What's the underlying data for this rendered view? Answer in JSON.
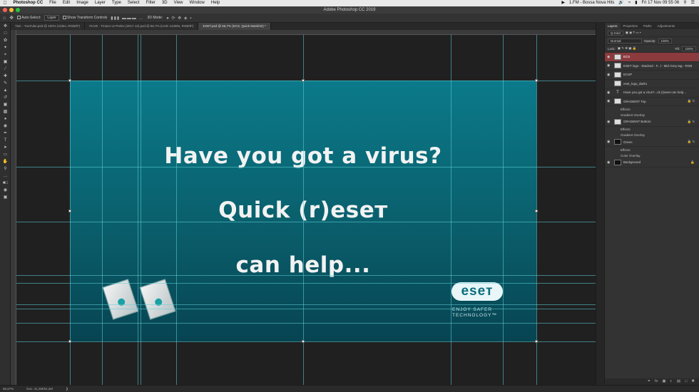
{
  "menubar": {
    "app_name": "Photoshop CC",
    "items": [
      "File",
      "Edit",
      "Image",
      "Layer",
      "Type",
      "Select",
      "Filter",
      "3D",
      "View",
      "Window",
      "Help"
    ],
    "now_playing": "1.FM - Bossa Nova Hits",
    "clock": "Fri 17 Nov  09 55 06"
  },
  "window": {
    "title": "Adobe Photoshop CC 2019"
  },
  "options": {
    "auto_select_label": "Auto-Select:",
    "auto_select_value": "Layer",
    "show_transform_label": "Show Transform Controls",
    "mode_3d_label": "3D Mode:"
  },
  "doc_tabs": [
    "T&C - YouTube.psd @ 100% (Video, RGB/8*)",
    "#LIVE - Tmavo vs Prelov (2017.12).psd @ 66,7% (LIVE 14400s, RGB/8*)",
    "ESET.psd @ 66,7% (ECS, Quick Mask/32) *"
  ],
  "artboard": {
    "line1": "Have you got a virus?",
    "line2": "Quick (r)eseт",
    "line3": "can help...",
    "logo_text": "eseт",
    "tagline1": "ENJOY SAFER",
    "tagline2": "TECHNOLOGY™"
  },
  "panel": {
    "tabs": [
      "Layers",
      "Properties",
      "Paths",
      "Adjustments"
    ],
    "filter_label": "Q Kind",
    "blend_mode": "Normal",
    "opacity_label": "Opacity:",
    "opacity_value": "100%",
    "lock_label": "Lock:",
    "fill_label": "Fill:",
    "fill_value": "100%",
    "layers": [
      {
        "name": "ECS",
        "type": "smart",
        "selected": true
      },
      {
        "name": "ESET logo - Stacked - F...l - Mid Grey tag - RGB",
        "type": "smart"
      },
      {
        "name": "ECSP",
        "type": "smart"
      },
      {
        "name": "eset_logo_dark1",
        "type": "image"
      },
      {
        "name": "Have you got a virus?...ck (r)eset can help...",
        "type": "text"
      },
      {
        "name": "GRADIENT Top",
        "type": "fill",
        "effects": [
          "Effects",
          "Gradient Overlay"
        ]
      },
      {
        "name": "GRADIENT Bottom",
        "type": "fill",
        "effects": [
          "Effects",
          "Gradient Overlay"
        ]
      },
      {
        "name": "Green",
        "type": "fill",
        "effects": [
          "Effects",
          "Color Overlay"
        ]
      },
      {
        "name": "Background",
        "type": "bg"
      }
    ]
  },
  "status": {
    "zoom": "66,67%",
    "doc": "Doc: 41,3M/54,2M"
  }
}
